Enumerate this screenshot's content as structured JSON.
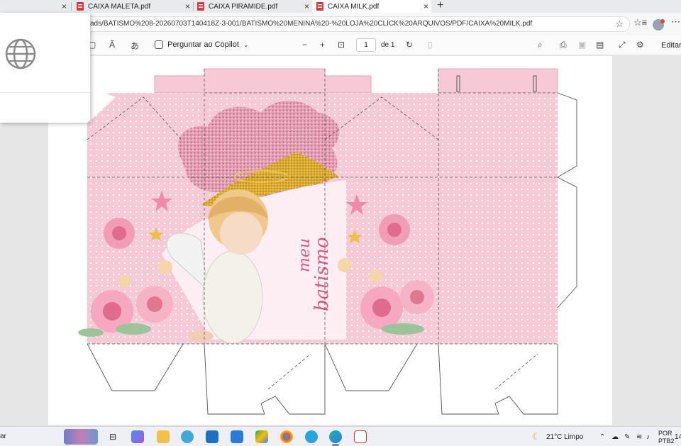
{
  "tabs": [
    {
      "title": "CAIXA MALETA.pdf",
      "active": false
    },
    {
      "title": "CAIXA PIRAMIDE.pdf",
      "active": false
    },
    {
      "title": "CAIXA MILK.pdf",
      "active": true
    }
  ],
  "address": {
    "url": "ads/BATISMO%208-20260703T140418Z-3-001/BATISMO%20MENINA%20-%20LOJA%20CLICK%20ARQUIVOS/PDF/CAIXA%20MILK.pdf"
  },
  "pdf_toolbar": {
    "copilot_label": "Perguntar ao Copilot",
    "page_current": "1",
    "page_total": "de 1",
    "edit_label": "Editar"
  },
  "document": {
    "text_line1": "meu",
    "text_line2": "batismo",
    "colors": {
      "pink_bg": "#f7c9d6",
      "dot": "#ffffff",
      "gold": "#d9a82a",
      "glitter": "#c9738e",
      "text_pink": "#e0577e",
      "star": "#ef8aa8"
    }
  },
  "taskbar": {
    "left_text": "ar",
    "weather": "21°C  Limpo",
    "lang1": "POR",
    "lang2": "PTB2",
    "clock": "14"
  }
}
